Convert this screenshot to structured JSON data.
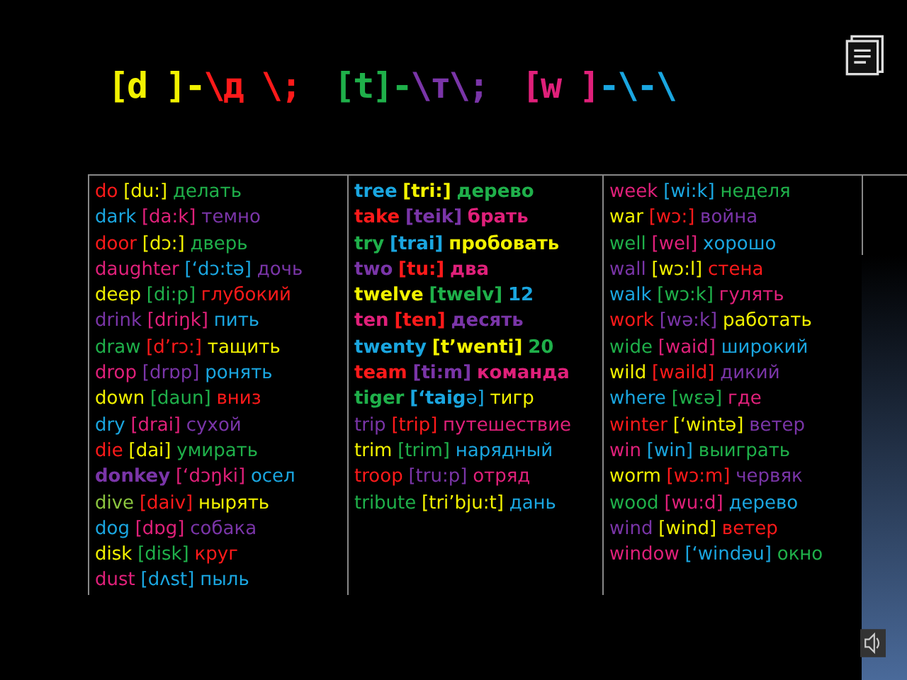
{
  "title": [
    {
      "text": "[d ]",
      "color": "#f2f200"
    },
    {
      "text": "-",
      "color": "#f2f200"
    },
    {
      "text": "\\д \\;",
      "color": "#ff1a1a"
    },
    {
      "text": "[t]",
      "color": "#1fb04a"
    },
    {
      "text": "-",
      "color": "#1fb04a"
    },
    {
      "text": "\\т\\;",
      "color": "#7a35a8"
    },
    {
      "text": "[w ]",
      "color": "#e0207a"
    },
    {
      "text": "-\\-\\",
      "color": "#1aa6e0"
    }
  ],
  "columns": [
    {
      "entries": [
        {
          "parts": [
            {
              "text": "do",
              "color": "#ff1a1a",
              "bold": false
            },
            {
              "text": "[du:]",
              "color": "#f2f200",
              "bold": false
            },
            {
              "text": "делать",
              "color": "#1fb04a",
              "bold": false
            }
          ]
        },
        {
          "parts": [
            {
              "text": "dark",
              "color": "#1aa6e0",
              "bold": false
            },
            {
              "text": "[da:k]",
              "color": "#e0207a",
              "bold": false
            },
            {
              "text": "темно",
              "color": "#7a35a8",
              "bold": false
            }
          ]
        },
        {
          "parts": [
            {
              "text": "door",
              "color": "#ff1a1a",
              "bold": false
            },
            {
              "text": "[dɔ:]",
              "color": "#f2f200",
              "bold": false
            },
            {
              "text": "дверь",
              "color": "#1fb04a",
              "bold": false
            }
          ]
        },
        {
          "parts": [
            {
              "text": "daughter",
              "color": "#e0207a",
              "bold": false
            },
            {
              "text": "[‘dɔ:tə]",
              "color": "#1aa6e0",
              "bold": false
            },
            {
              "text": "дочь",
              "color": "#7a35a8",
              "bold": false
            }
          ]
        },
        {
          "parts": [
            {
              "text": "deep",
              "color": "#f2f200",
              "bold": false
            },
            {
              "text": "[di:p]",
              "color": "#1fb04a",
              "bold": false
            },
            {
              "text": "глубокий",
              "color": "#ff1a1a",
              "bold": false
            }
          ]
        },
        {
          "parts": [
            {
              "text": "drink",
              "color": "#7a35a8",
              "bold": false
            },
            {
              "text": "[driŋk]",
              "color": "#e0207a",
              "bold": false
            },
            {
              "text": "пить",
              "color": "#1aa6e0",
              "bold": false
            }
          ]
        },
        {
          "parts": [
            {
              "text": "draw",
              "color": "#1fb04a",
              "bold": false
            },
            {
              "text": "[d’rɔ:]",
              "color": "#ff1a1a",
              "bold": false
            },
            {
              "text": "тащить",
              "color": "#f2f200",
              "bold": false
            }
          ]
        },
        {
          "parts": [
            {
              "text": "drop",
              "color": "#e0207a",
              "bold": false
            },
            {
              "text": "[drɒp]",
              "color": "#7a35a8",
              "bold": false
            },
            {
              "text": "ронять",
              "color": "#1aa6e0",
              "bold": false
            }
          ]
        },
        {
          "parts": [
            {
              "text": "down",
              "color": "#f2f200",
              "bold": false
            },
            {
              "text": "[daun]",
              "color": "#1fb04a",
              "bold": false
            },
            {
              "text": "вниз",
              "color": "#ff1a1a",
              "bold": false
            }
          ]
        },
        {
          "parts": [
            {
              "text": "dry",
              "color": "#1aa6e0",
              "bold": false
            },
            {
              "text": "[drai]",
              "color": "#e0207a",
              "bold": false
            },
            {
              "text": "сухой",
              "color": "#7a35a8",
              "bold": false
            }
          ]
        },
        {
          "parts": [
            {
              "text": "die",
              "color": "#ff1a1a",
              "bold": false
            },
            {
              "text": "[dai]",
              "color": "#f2f200",
              "bold": false
            },
            {
              "text": "умирать",
              "color": "#1fb04a",
              "bold": false
            }
          ]
        },
        {
          "parts": [
            {
              "text": "donkey",
              "color": "#7a35a8",
              "bold": true
            },
            {
              "text": "[‘dɔŋki]",
              "color": "#e0207a",
              "bold": false
            },
            {
              "text": "осел",
              "color": "#1aa6e0",
              "bold": false
            }
          ]
        },
        {
          "parts": [
            {
              "text": "dive",
              "color": "#8cc63f",
              "bold": false
            },
            {
              "text": "[daiv]",
              "color": "#ff1a1a",
              "bold": false
            },
            {
              "text": "нырять",
              "color": "#f2f200",
              "bold": false
            }
          ]
        },
        {
          "parts": [
            {
              "text": "dog",
              "color": "#1aa6e0",
              "bold": false
            },
            {
              "text": "[dɒg]",
              "color": "#e0207a",
              "bold": false
            },
            {
              "text": "собака",
              "color": "#7a35a8",
              "bold": false
            }
          ]
        },
        {
          "parts": [
            {
              "text": "disk",
              "color": "#f2f200",
              "bold": false
            },
            {
              "text": "[disk]",
              "color": "#1fb04a",
              "bold": false
            },
            {
              "text": "круг",
              "color": "#ff1a1a",
              "bold": false
            }
          ]
        },
        {
          "parts": [
            {
              "text": "dust",
              "color": "#e0207a",
              "bold": false
            },
            {
              "text": "[dʌst]",
              "color": "#1aa6e0",
              "bold": false
            },
            {
              "text": "пыль",
              "color": "#1aa6e0",
              "bold": false
            }
          ]
        }
      ]
    },
    {
      "entries": [
        {
          "parts": [
            {
              "text": "tree",
              "color": "#1aa6e0",
              "bold": true
            },
            {
              "text": "[tri:]",
              "color": "#f2f200",
              "bold": true
            },
            {
              "text": "дерево",
              "color": "#1fb04a",
              "bold": true
            }
          ]
        },
        {
          "parts": [
            {
              "text": "take",
              "color": "#ff1a1a",
              "bold": true
            },
            {
              "text": "[teik]",
              "color": "#7a35a8",
              "bold": true
            },
            {
              "text": "брать",
              "color": "#e0207a",
              "bold": true
            }
          ]
        },
        {
          "parts": [
            {
              "text": "try",
              "color": "#1fb04a",
              "bold": true
            },
            {
              "text": "[trai]",
              "color": "#1aa6e0",
              "bold": true
            },
            {
              "text": "пробовать",
              "color": "#f2f200",
              "bold": true
            }
          ]
        },
        {
          "parts": [
            {
              "text": "two",
              "color": "#7a35a8",
              "bold": true
            },
            {
              "text": "[tu:]",
              "color": "#ff1a1a",
              "bold": true
            },
            {
              "text": "два",
              "color": "#e0207a",
              "bold": true
            }
          ]
        },
        {
          "parts": [
            {
              "text": "twelve",
              "color": "#f2f200",
              "bold": true
            },
            {
              "text": "[twelv]",
              "color": "#1fb04a",
              "bold": true
            },
            {
              "text": "12",
              "color": "#1aa6e0",
              "bold": true
            }
          ]
        },
        {
          "parts": [
            {
              "text": "ten",
              "color": "#e0207a",
              "bold": true
            },
            {
              "text": "[ten]",
              "color": "#ff1a1a",
              "bold": true
            },
            {
              "text": "десять",
              "color": "#7a35a8",
              "bold": true
            }
          ]
        },
        {
          "parts": [
            {
              "text": "twenty",
              "color": "#1aa6e0",
              "bold": true
            },
            {
              "text": "[t’wenti]",
              "color": "#f2f200",
              "bold": true
            },
            {
              "text": "20",
              "color": "#1fb04a",
              "bold": true
            }
          ]
        },
        {
          "parts": [
            {
              "text": "team",
              "color": "#ff1a1a",
              "bold": true
            },
            {
              "text": "[ti:m]",
              "color": "#7a35a8",
              "bold": true
            },
            {
              "text": "команда",
              "color": "#e0207a",
              "bold": true
            }
          ]
        },
        {
          "parts": [
            {
              "text": "tiger",
              "color": "#1fb04a",
              "bold": true
            },
            {
              "text": "**[‘taig**ə]",
              "color": "#1aa6e0",
              "bold": false
            },
            {
              "text": "тигр",
              "color": "#f2f200",
              "bold": false
            }
          ]
        },
        {
          "parts": [
            {
              "text": "trip",
              "color": "#7a35a8",
              "bold": false
            },
            {
              "text": "[trip]",
              "color": "#ff1a1a",
              "bold": false
            },
            {
              "text": "путешествие",
              "color": "#e0207a",
              "bold": false
            }
          ]
        },
        {
          "parts": [
            {
              "text": "trim",
              "color": "#f2f200",
              "bold": false
            },
            {
              "text": "[trim]",
              "color": "#1fb04a",
              "bold": false
            },
            {
              "text": "нарядный",
              "color": "#1aa6e0",
              "bold": false
            }
          ]
        },
        {
          "parts": [
            {
              "text": "troop",
              "color": "#ff1a1a",
              "bold": false
            },
            {
              "text": "[tru:p]",
              "color": "#7a35a8",
              "bold": false
            },
            {
              "text": "отряд",
              "color": "#e0207a",
              "bold": false
            }
          ]
        },
        {
          "parts": [
            {
              "text": "tribute",
              "color": "#1fb04a",
              "bold": false
            },
            {
              "text": "[tri’bju:t]",
              "color": "#f2f200",
              "bold": false
            },
            {
              "text": "дань",
              "color": "#1aa6e0",
              "bold": false
            }
          ]
        }
      ]
    },
    {
      "entries": [
        {
          "parts": [
            {
              "text": "week",
              "color": "#e0207a",
              "bold": false
            },
            {
              "text": "[wi:k]",
              "color": "#1aa6e0",
              "bold": false
            },
            {
              "text": "неделя",
              "color": "#1fb04a",
              "bold": false
            }
          ]
        },
        {
          "parts": [
            {
              "text": "war",
              "color": "#f2f200",
              "bold": false
            },
            {
              "text": "[wɔ:]",
              "color": "#ff1a1a",
              "bold": false
            },
            {
              "text": "война",
              "color": "#7a35a8",
              "bold": false
            }
          ]
        },
        {
          "parts": [
            {
              "text": "well",
              "color": "#1fb04a",
              "bold": false
            },
            {
              "text": "[wel]",
              "color": "#e0207a",
              "bold": false
            },
            {
              "text": "хорошо",
              "color": "#1aa6e0",
              "bold": false
            }
          ]
        },
        {
          "parts": [
            {
              "text": "wall",
              "color": "#7a35a8",
              "bold": false
            },
            {
              "text": "[wɔ:l]",
              "color": "#f2f200",
              "bold": false
            },
            {
              "text": "стена",
              "color": "#ff1a1a",
              "bold": false
            }
          ]
        },
        {
          "parts": [
            {
              "text": "walk",
              "color": "#1aa6e0",
              "bold": false
            },
            {
              "text": "[wɔ:k]",
              "color": "#1fb04a",
              "bold": false
            },
            {
              "text": "гулять",
              "color": "#e0207a",
              "bold": false
            }
          ]
        },
        {
          "parts": [
            {
              "text": "work",
              "color": "#ff1a1a",
              "bold": false
            },
            {
              "text": "[wə:k]",
              "color": "#7a35a8",
              "bold": false
            },
            {
              "text": "работать",
              "color": "#f2f200",
              "bold": false
            }
          ]
        },
        {
          "parts": [
            {
              "text": "wide",
              "color": "#1fb04a",
              "bold": false
            },
            {
              "text": "[waid]",
              "color": "#e0207a",
              "bold": false
            },
            {
              "text": "широкий",
              "color": "#1aa6e0",
              "bold": false
            }
          ]
        },
        {
          "parts": [
            {
              "text": "wild",
              "color": "#f2f200",
              "bold": false
            },
            {
              "text": "[waild]",
              "color": "#ff1a1a",
              "bold": false
            },
            {
              "text": "дикий",
              "color": "#7a35a8",
              "bold": false
            }
          ]
        },
        {
          "parts": [
            {
              "text": "where",
              "color": "#1aa6e0",
              "bold": false
            },
            {
              "text": "[wɛə]",
              "color": "#1fb04a",
              "bold": false
            },
            {
              "text": "где",
              "color": "#e0207a",
              "bold": false
            }
          ]
        },
        {
          "parts": [
            {
              "text": "winter",
              "color": "#ff1a1a",
              "bold": false
            },
            {
              "text": "[‘wintə]",
              "color": "#f2f200",
              "bold": false
            },
            {
              "text": "ветер",
              "color": "#7a35a8",
              "bold": false
            }
          ]
        },
        {
          "parts": [
            {
              "text": "win",
              "color": "#e0207a",
              "bold": false
            },
            {
              "text": "[win]",
              "color": "#1aa6e0",
              "bold": false
            },
            {
              "text": "выиграть",
              "color": "#1fb04a",
              "bold": false
            }
          ]
        },
        {
          "parts": [
            {
              "text": "worm",
              "color": "#f2f200",
              "bold": false
            },
            {
              "text": "[wɔ:m]",
              "color": "#ff1a1a",
              "bold": false
            },
            {
              "text": "червяк",
              "color": "#7a35a8",
              "bold": false
            }
          ]
        },
        {
          "parts": [
            {
              "text": "wood",
              "color": "#1fb04a",
              "bold": false
            },
            {
              "text": "[wu:d]",
              "color": "#e0207a",
              "bold": false
            },
            {
              "text": "дерево",
              "color": "#1aa6e0",
              "bold": false
            }
          ]
        },
        {
          "parts": [
            {
              "text": "wind",
              "color": "#7a35a8",
              "bold": false
            },
            {
              "text": "[wind]",
              "color": "#f2f200",
              "bold": false
            },
            {
              "text": "ветер",
              "color": "#ff1a1a",
              "bold": false
            }
          ]
        },
        {
          "parts": [
            {
              "text": "window",
              "color": "#e0207a",
              "bold": false
            },
            {
              "text": "[‘windəu]",
              "color": "#1aa6e0",
              "bold": false
            },
            {
              "text": "окно",
              "color": "#1fb04a",
              "bold": false
            }
          ]
        }
      ]
    }
  ]
}
